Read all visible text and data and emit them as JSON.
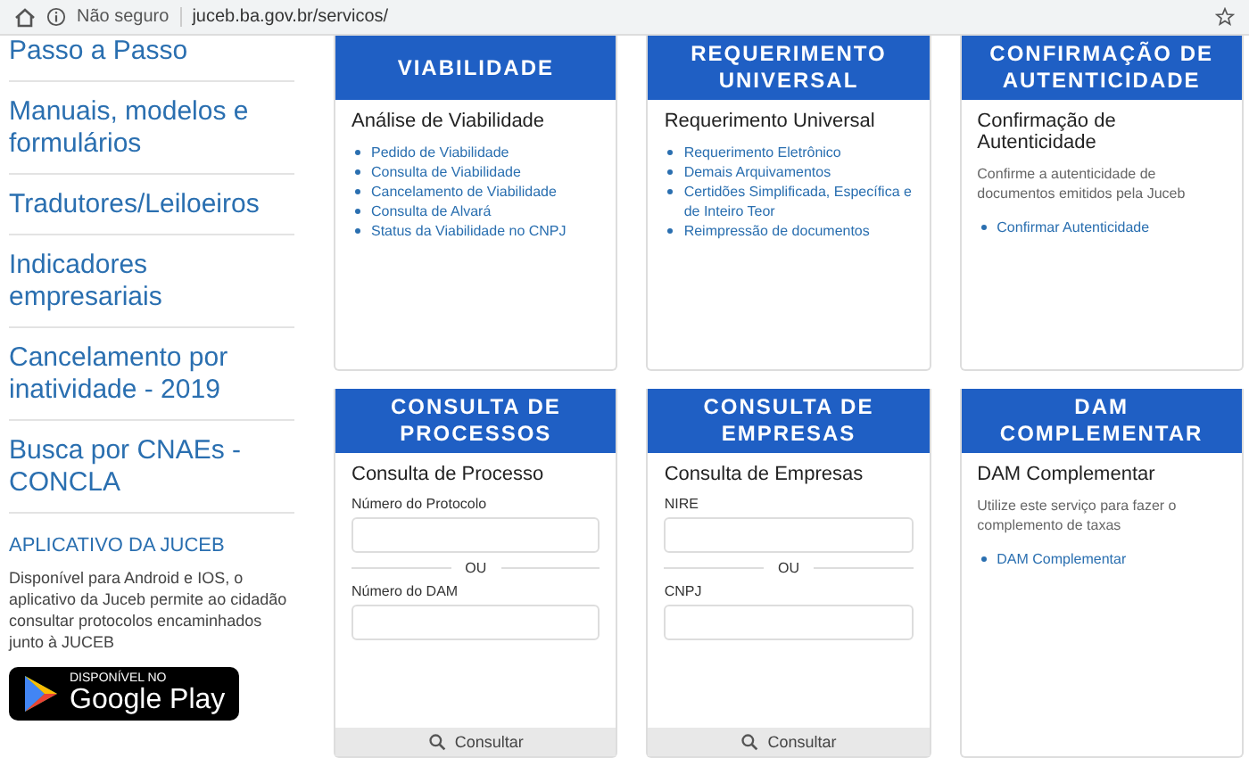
{
  "browser": {
    "security": "Não seguro",
    "url": "juceb.ba.gov.br/servicos/"
  },
  "sidebar": {
    "links": [
      "Passo a Passo",
      "Manuais, modelos e formulários",
      "Tradutores/Leiloeiros",
      "Indicadores empresariais",
      "Cancelamento por inatividade - 2019",
      "Busca por CNAEs - CONCLA"
    ],
    "app": {
      "title": "APLICATIVO DA JUCEB",
      "text": "Disponível para Android e IOS, o aplicativo da Juceb permite ao cidadão consultar protocolos encaminhados junto à JUCEB",
      "badge_small": "DISPONÍVEL NO",
      "badge_big": "Google Play"
    }
  },
  "cards": [
    {
      "kind": "links",
      "header": "VIABILIDADE",
      "title": "Análise de Viabilidade",
      "links": [
        "Pedido de Viabilidade",
        "Consulta de Viabilidade",
        "Cancelamento de Viabilidade",
        "Consulta de Alvará",
        "Status da Viabilidade no CNPJ"
      ]
    },
    {
      "kind": "links",
      "header": "REQUERIMENTO UNIVERSAL",
      "title": "Requerimento Universal",
      "links": [
        "Requerimento Eletrônico",
        "Demais Arquivamentos",
        "Certidões Simplificada, Específica e de Inteiro Teor",
        "Reimpressão de documentos"
      ]
    },
    {
      "kind": "links",
      "header": "CONFIRMAÇÃO DE AUTENTICIDADE",
      "title": "Confirmação de Autenticidade",
      "description": "Confirme a autenticidade de documentos emitidos pela Juceb",
      "links": [
        "Confirmar Autenticidade"
      ]
    },
    {
      "kind": "form",
      "header": "CONSULTA DE PROCESSOS",
      "title": "Consulta de Processo",
      "fields": [
        "Número do Protocolo",
        "Número do DAM"
      ],
      "separator": "OU",
      "button": "Consultar"
    },
    {
      "kind": "form",
      "header": "CONSULTA DE EMPRESAS",
      "title": "Consulta de Empresas",
      "fields": [
        "NIRE",
        "CNPJ"
      ],
      "separator": "OU",
      "button": "Consultar"
    },
    {
      "kind": "links",
      "header": "DAM COMPLEMENTAR",
      "title": "DAM Complementar",
      "description": "Utilize este serviço para fazer o complemento de taxas",
      "links": [
        "DAM Complementar"
      ]
    }
  ]
}
